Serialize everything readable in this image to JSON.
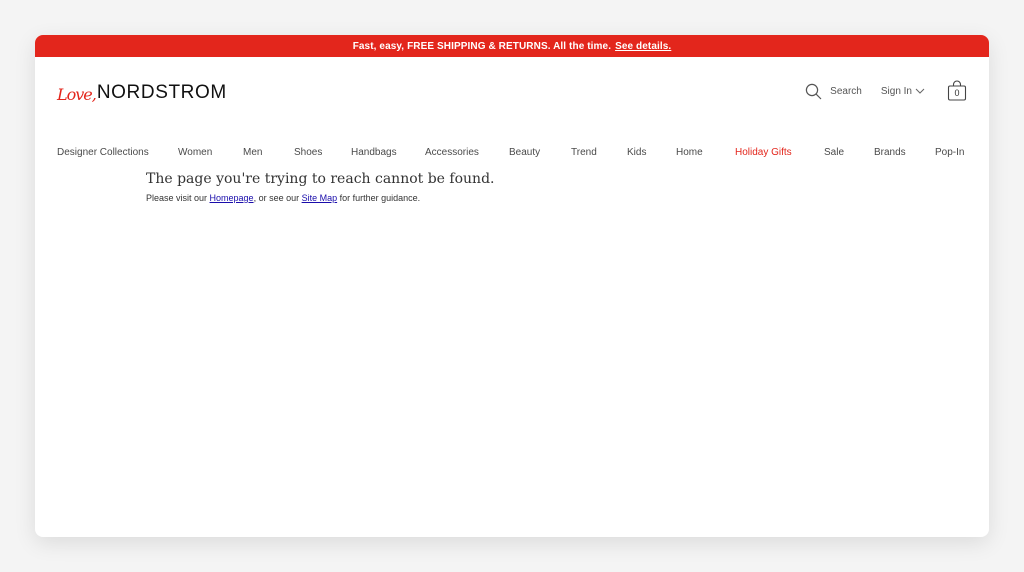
{
  "promo": {
    "text": "Fast, easy, FREE SHIPPING & RETURNS. All the time.",
    "link": "See details."
  },
  "header": {
    "logo_script": "Love,",
    "logo_text": "NORDSTROM",
    "search_label": "Search",
    "signin_label": "Sign In",
    "bag_count": "0"
  },
  "nav": {
    "items": [
      "Designer Collections",
      "Women",
      "Men",
      "Shoes",
      "Handbags",
      "Accessories",
      "Beauty",
      "Trend",
      "Kids",
      "Home",
      "Holiday Gifts",
      "Sale",
      "Brands",
      "Pop-In"
    ],
    "accent_item": "Holiday Gifts",
    "accent_color": "#e3261c"
  },
  "error": {
    "title": "The page you're trying to reach cannot be found.",
    "sub_before": "Please visit our ",
    "homepage_link": "Homepage",
    "sub_middle": ", or see our ",
    "sitemap_link": "Site Map",
    "sub_after": " for further guidance."
  },
  "colors": {
    "brand_red": "#e3261c",
    "link_blue": "#1a0dab"
  }
}
